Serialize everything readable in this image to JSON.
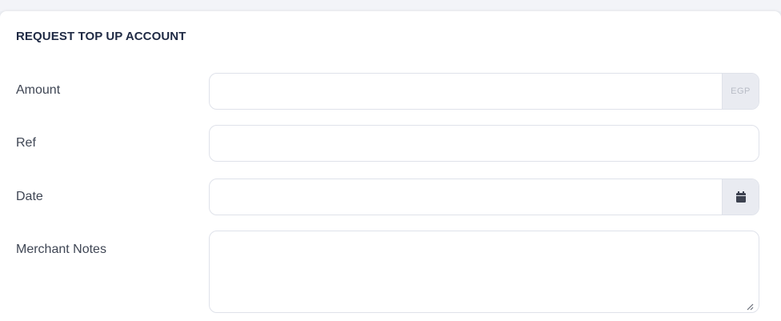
{
  "form": {
    "title": "REQUEST TOP UP ACCOUNT",
    "amount": {
      "label": "Amount",
      "value": "",
      "placeholder": "",
      "currency": "EGP"
    },
    "ref": {
      "label": "Ref",
      "value": "",
      "placeholder": ""
    },
    "date": {
      "label": "Date",
      "value": "",
      "placeholder": "",
      "icon": "calendar-icon"
    },
    "merchant_notes": {
      "label": "Merchant Notes",
      "value": "",
      "placeholder": ""
    }
  },
  "colors": {
    "title": "#1f2a44",
    "label": "#3f4654",
    "border": "#dfe2ea",
    "addon_bg": "#e9ebf1",
    "icon": "#3d4250"
  }
}
